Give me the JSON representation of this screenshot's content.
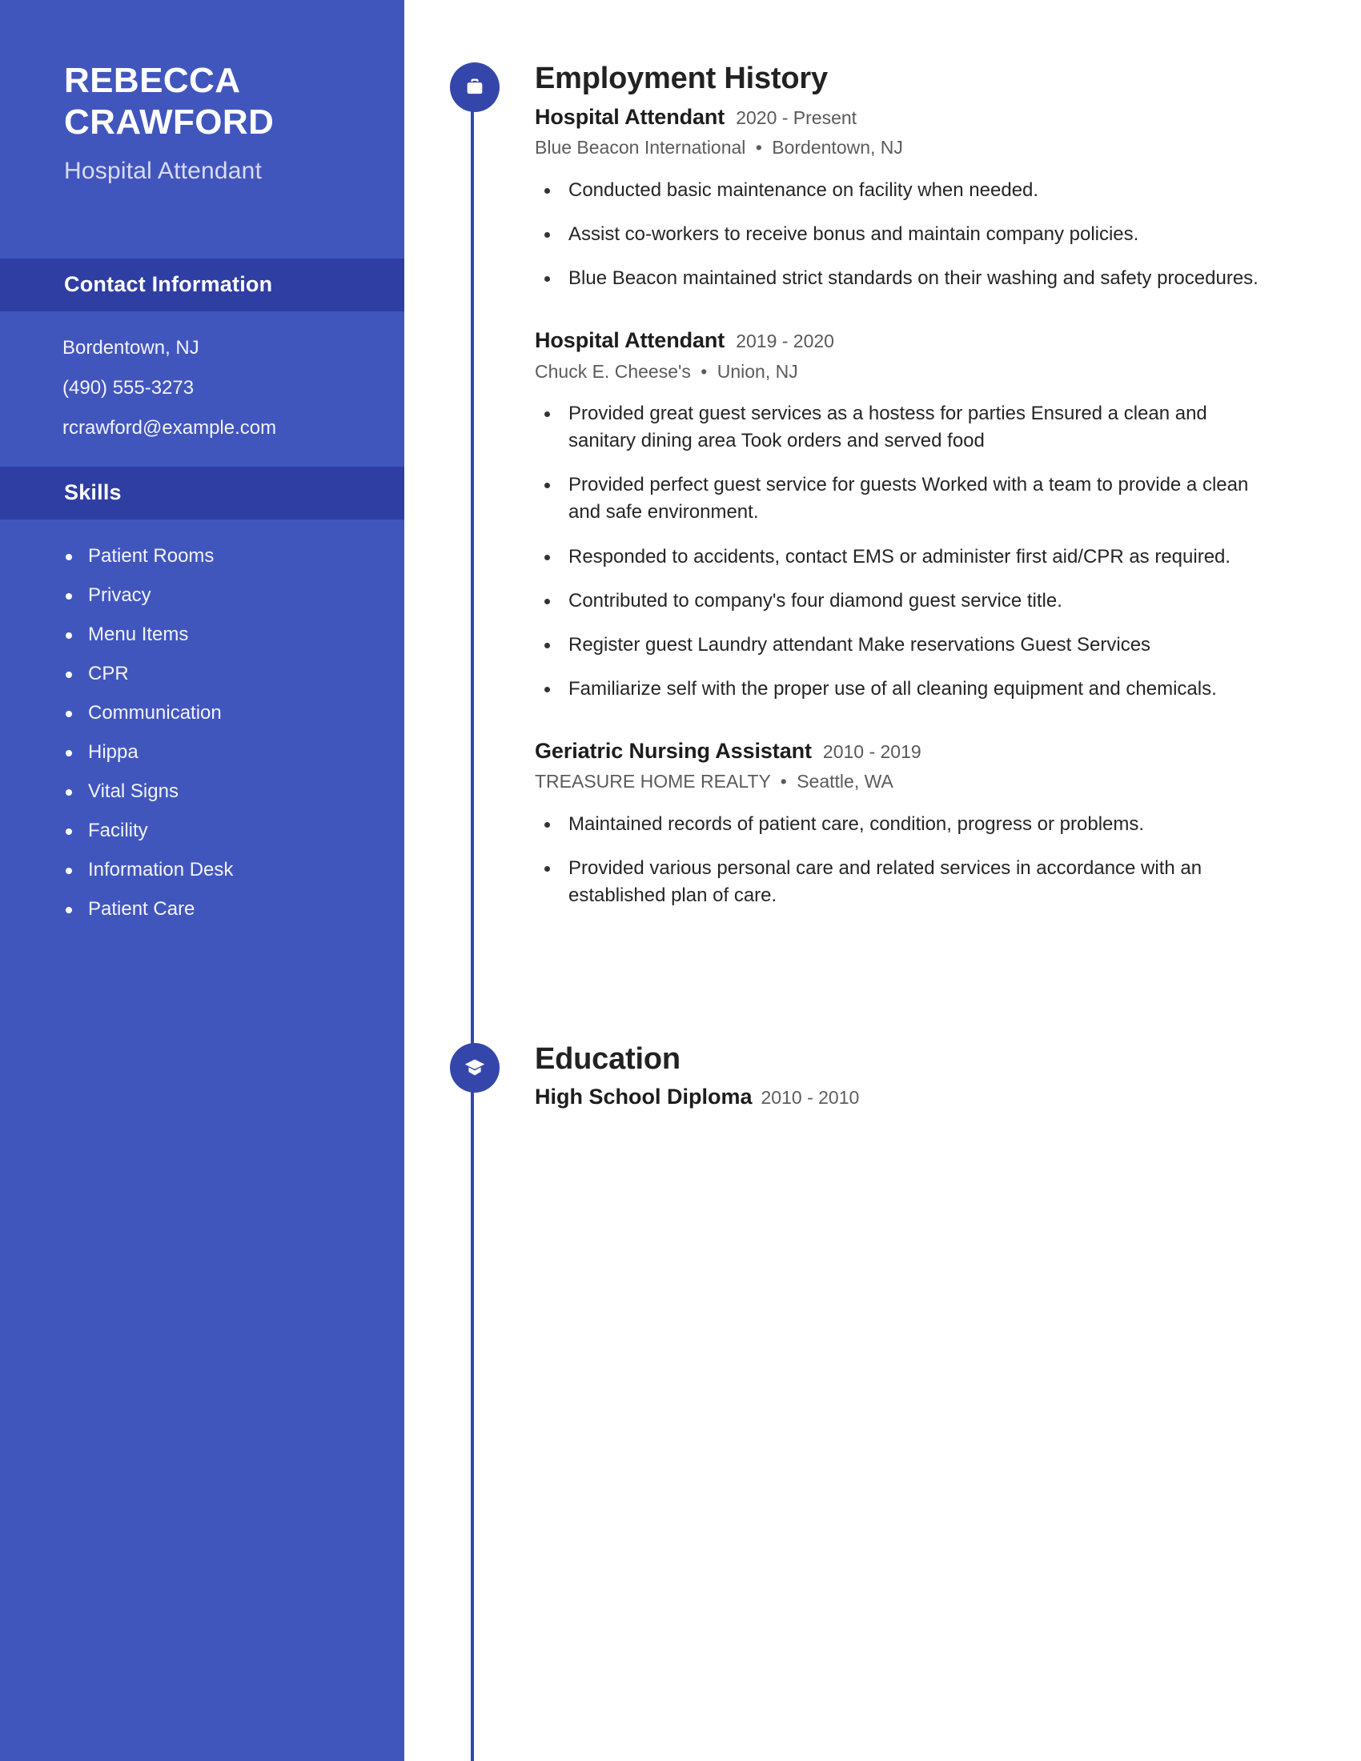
{
  "colors": {
    "sidebar_bg": "#4156bd",
    "sidebar_header_bg": "#2f3ea2",
    "accent_icon": "#3546ab",
    "timeline": "#3647ac",
    "text_dark": "#222222",
    "text_muted": "#5b5b5b"
  },
  "sidebar": {
    "name_line1": "REBECCA",
    "name_line2": "CRAWFORD",
    "job_title": "Hospital Attendant",
    "contact": {
      "header": "Contact Information",
      "location": "Bordentown, NJ",
      "phone": "(490) 555-3273",
      "email": "rcrawford@example.com"
    },
    "skills": {
      "header": "Skills",
      "items": [
        "Patient Rooms",
        "Privacy",
        "Menu Items",
        "CPR",
        "Communication",
        "Hippa",
        "Vital Signs",
        "Facility",
        "Information Desk",
        "Patient Care"
      ]
    }
  },
  "main": {
    "employment": {
      "title": "Employment History",
      "icon": "briefcase-icon",
      "entries": [
        {
          "role": "Hospital Attendant",
          "dates": "2020 - Present",
          "company": "Blue Beacon International",
          "separator": "•",
          "location": "Bordentown, NJ",
          "bullets": [
            "Conducted basic maintenance on facility when needed.",
            "Assist co-workers to receive bonus and maintain company policies.",
            "Blue Beacon maintained strict standards on their washing and safety procedures."
          ]
        },
        {
          "role": "Hospital Attendant",
          "dates": "2019 - 2020",
          "company": "Chuck E. Cheese's",
          "separator": "•",
          "location": "Union, NJ",
          "bullets": [
            "Provided great guest services as a hostess for parties Ensured a clean and sanitary dining area Took orders and served food",
            "Provided perfect guest service for guests Worked with a team to provide a clean and safe environment.",
            "Responded to accidents, contact EMS or administer first aid/CPR as required.",
            "Contributed to company's four diamond guest service title.",
            "Register guest Laundry attendant Make reservations Guest Services",
            "Familiarize self with the proper use of all cleaning equipment and chemicals."
          ]
        },
        {
          "role": "Geriatric Nursing Assistant",
          "dates": "2010 - 2019",
          "company": "TREASURE HOME REALTY",
          "separator": "•",
          "location": "Seattle, WA",
          "bullets": [
            "Maintained records of patient care, condition, progress or problems.",
            "Provided various personal care and related services in accordance with an established plan of care."
          ]
        }
      ]
    },
    "education": {
      "title": "Education",
      "icon": "graduation-cap-icon",
      "entries": [
        {
          "degree": "High School Diploma",
          "dates": "2010 - 2010"
        }
      ]
    }
  }
}
